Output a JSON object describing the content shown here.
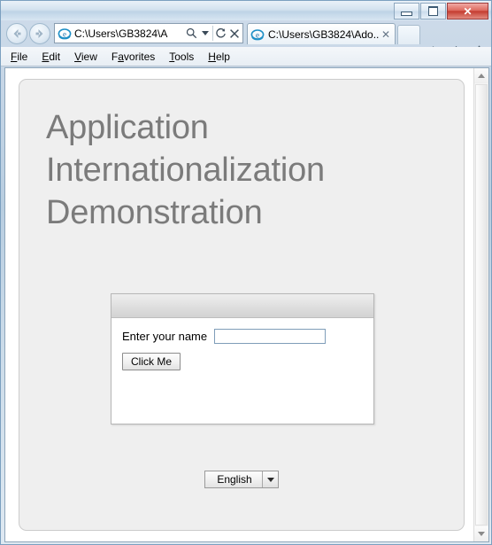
{
  "window": {
    "controls": {
      "minimize": "minimize-button",
      "maximize": "maximize-button",
      "close_label": "✕"
    }
  },
  "navigation": {
    "back_icon": "back-arrow-icon",
    "forward_icon": "forward-arrow-icon",
    "address_value": "C:\\Users\\GB3824\\A",
    "address_placeholder": "",
    "search_icon": "search-icon",
    "dropdown_icon": "chevron-down-icon",
    "refresh_icon": "refresh-icon",
    "stop_icon": "stop-icon"
  },
  "tabs": [
    {
      "title": "C:\\Users\\GB3824\\Ado...",
      "close_label": "✕",
      "active": true
    }
  ],
  "toolbar": {
    "home_icon": "home-icon",
    "favorites_icon": "star-icon",
    "tools_icon": "gear-icon"
  },
  "menubar": {
    "items": [
      {
        "label": "File",
        "pre": "",
        "accel": "F",
        "post": "ile"
      },
      {
        "label": "Edit",
        "pre": "",
        "accel": "E",
        "post": "dit"
      },
      {
        "label": "View",
        "pre": "",
        "accel": "V",
        "post": "iew"
      },
      {
        "label": "Favorites",
        "pre": "F",
        "accel": "a",
        "post": "vorites"
      },
      {
        "label": "Tools",
        "pre": "",
        "accel": "T",
        "post": "ools"
      },
      {
        "label": "Help",
        "pre": "",
        "accel": "H",
        "post": "elp"
      }
    ]
  },
  "page": {
    "title": "Application Internationalization Demonstration",
    "form": {
      "header_text": "",
      "name_label": "Enter your name",
      "name_value": "",
      "name_placeholder": "",
      "button_label": "Click Me"
    },
    "language": {
      "selected": "English",
      "options": [
        "English"
      ]
    }
  },
  "colors": {
    "title_gray": "#7b7b7b",
    "page_bg": "#efefef",
    "input_border": "#7f9db9",
    "close_red": "#c43c30"
  },
  "scrollbar": {
    "up_icon": "scroll-up-icon",
    "down_icon": "scroll-down-icon"
  }
}
